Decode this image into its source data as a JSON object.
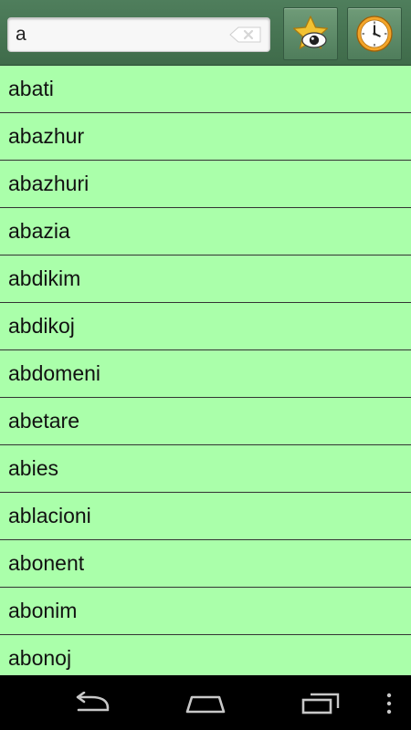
{
  "search": {
    "value": "a"
  },
  "toolbar": {
    "clear_icon": "backspace-clear-icon",
    "favorites_icon": "star-eye-icon",
    "history_icon": "clock-icon"
  },
  "words": [
    "abati",
    "abazhur",
    "abazhuri",
    "abazia",
    "abdikim",
    "abdikoj",
    "abdomeni",
    "abetare",
    "abies",
    "ablacioni",
    "abonent",
    "abonim",
    "abonoj"
  ],
  "navbar": {
    "back_icon": "back-arrow-icon",
    "home_icon": "home-icon",
    "recents_icon": "recent-apps-icon",
    "menu_icon": "overflow-menu-icon"
  },
  "colors": {
    "toolbar": "#4a7655",
    "list_background": "#aaffaa",
    "divider": "#333333"
  }
}
